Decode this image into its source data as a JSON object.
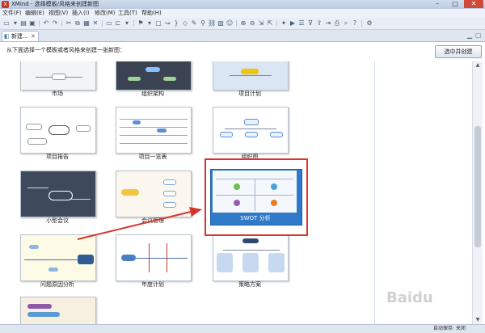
{
  "window": {
    "title": "XMind - 选择模板/风格来创建新图"
  },
  "menu": [
    "文件(F)",
    "编辑(E)",
    "视图(V)",
    "插入(I)",
    "修改(M)",
    "工具(T)",
    "帮助(H)"
  ],
  "editor_tab": {
    "label": "新建..."
  },
  "instruction": "从下面选择一个模板或者风格来创建一张新图：",
  "create_button": "选中并创建",
  "templates": {
    "market": "市场",
    "org": "组织架构",
    "project_plan": "项目计划",
    "project_report": "项目报告",
    "project_overview": "项目一览表",
    "org_chart": "组织图",
    "small_meeting": "小型会议",
    "meeting_mgmt": "会议管理",
    "swot": "SWOT 分析",
    "problem_cause": "问题原因分析",
    "annual_plan": "年度计划",
    "strategy": "策略方案"
  },
  "status": {
    "autosave": "自动保存: 关闭"
  },
  "watermark": "Baidu",
  "colors": {
    "selection_border": "#d9342b",
    "selection_fill": "#2f79c9",
    "arrow": "#d9342b"
  }
}
